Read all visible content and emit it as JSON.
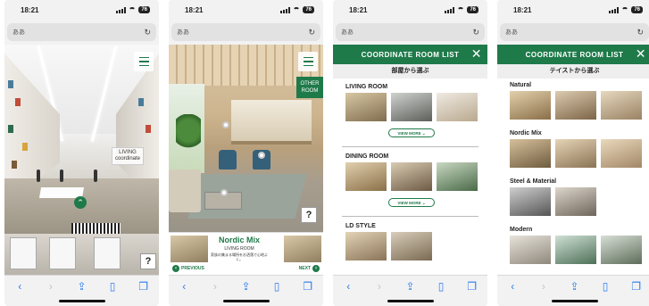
{
  "colors": {
    "accent": "#1f7a4a",
    "link": "#2a7bf0"
  },
  "status_bar": {
    "time": "18:21",
    "battery": "76"
  },
  "url_bar": {
    "text": "ああ"
  },
  "toolbar_icons": [
    "chevron-left-icon",
    "chevron-right-icon",
    "share-icon",
    "bookmarks-icon",
    "tabs-icon"
  ],
  "screen1": {
    "sign_text": "LIVING coordinate",
    "help_label": "?"
  },
  "screen2": {
    "other_room_label_1": "OTHER",
    "other_room_label_2": "ROOM",
    "help_label": "?",
    "banner_title": "Nordic Mix",
    "banner_subtitle": "LIVING ROOM",
    "banner_desc": "家族の集まる場所をお洒落で心地よく。",
    "prev_label": "PREVIOUS",
    "next_label": "NEXT"
  },
  "screen3": {
    "header_title": "COORDINATE ROOM LIST",
    "subhead": "部屋から選ぶ",
    "sections": [
      {
        "title": "LIVING ROOM",
        "view_more": "VIEW MORE"
      },
      {
        "title": "DINING ROOM",
        "view_more": "VIEW MORE"
      },
      {
        "title": "LD STYLE"
      }
    ]
  },
  "screen4": {
    "header_title": "COORDINATE ROOM LIST",
    "subhead": "テイストから選ぶ",
    "sections": [
      {
        "title": "Natural"
      },
      {
        "title": "Nordic Mix"
      },
      {
        "title": "Steel & Material"
      },
      {
        "title": "Modern"
      }
    ]
  }
}
